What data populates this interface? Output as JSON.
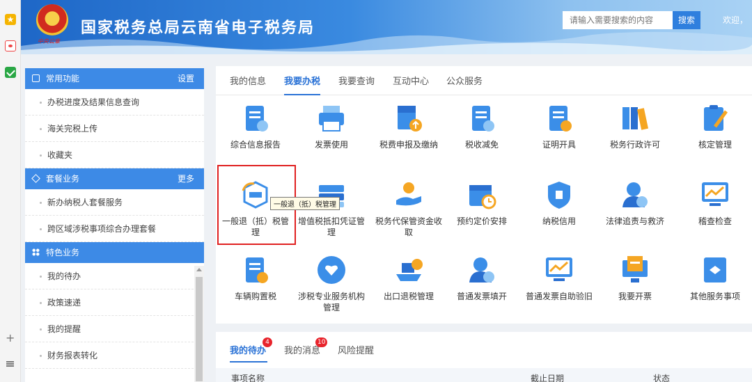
{
  "header": {
    "site_title": "国家税务总局云南省电子税务局",
    "emblem_text": "中央公章",
    "search_placeholder": "请输入需要搜索的内容",
    "search_button": "搜索",
    "welcome": "欢迎，"
  },
  "sidebar": {
    "sections": [
      {
        "title": "常用功能",
        "more": "设置",
        "items": [
          "办税进度及结果信息查询",
          "海关完税上传",
          "收藏夹"
        ]
      },
      {
        "title": "套餐业务",
        "more": "更多",
        "items": [
          "新办纳税人套餐服务",
          "跨区域涉税事项综合办理套餐"
        ]
      },
      {
        "title": "特色业务",
        "more": "",
        "items": [
          "我的待办",
          "政策速递",
          "我的提醒",
          "财务报表转化"
        ]
      }
    ]
  },
  "main": {
    "tabs": [
      "我的信息",
      "我要办税",
      "我要查询",
      "互动中心",
      "公众服务"
    ],
    "active_tab": "我要办税",
    "services": [
      {
        "label": "综合信息报告",
        "icon": "report-doc-icon"
      },
      {
        "label": "发票使用",
        "icon": "printer-icon"
      },
      {
        "label": "税费申报及缴纳",
        "icon": "declare-upload-icon"
      },
      {
        "label": "税收减免",
        "icon": "tax-reduction-icon"
      },
      {
        "label": "证明开具",
        "icon": "certificate-icon"
      },
      {
        "label": "税务行政许可",
        "icon": "binders-icon"
      },
      {
        "label": "核定管理",
        "icon": "clipboard-edit-icon"
      },
      {
        "label": "一般退（抵）税管理",
        "icon": "refund-icon"
      },
      {
        "label": "增值税抵扣凭证管理",
        "icon": "voucher-stack-icon"
      },
      {
        "label": "税务代保管资金收取",
        "icon": "hand-coin-icon"
      },
      {
        "label": "预约定价安排",
        "icon": "calendar-clock-icon"
      },
      {
        "label": "纳税信用",
        "icon": "credit-shield-icon"
      },
      {
        "label": "法律追责与救济",
        "icon": "law-person-icon"
      },
      {
        "label": "稽查检查",
        "icon": "monitor-chart-icon"
      },
      {
        "label": "车辆购置税",
        "icon": "vehicle-tax-icon"
      },
      {
        "label": "涉税专业服务机构管理",
        "icon": "heart-hand-icon"
      },
      {
        "label": "出口退税管理",
        "icon": "ship-export-icon"
      },
      {
        "label": "普通发票填开",
        "icon": "invoice-person-icon"
      },
      {
        "label": "普通发票自助验旧",
        "icon": "monitor-trend-icon"
      },
      {
        "label": "我要开票",
        "icon": "invoice-monitor-icon"
      },
      {
        "label": "其他服务事项",
        "icon": "other-layers-icon"
      }
    ],
    "tooltip": "一般退（抵）税管理"
  },
  "todo": {
    "tabs": [
      {
        "label": "我的待办",
        "badge": "4"
      },
      {
        "label": "我的消息",
        "badge": "10"
      },
      {
        "label": "风险提醒",
        "badge": ""
      }
    ],
    "columns": [
      "事项名称",
      "截止日期",
      "状态"
    ]
  },
  "colors": {
    "primary": "#2a72d6",
    "sidebar_header": "#3d8ae6",
    "badge": "#e8242c",
    "highlight_box": "#e02020"
  }
}
